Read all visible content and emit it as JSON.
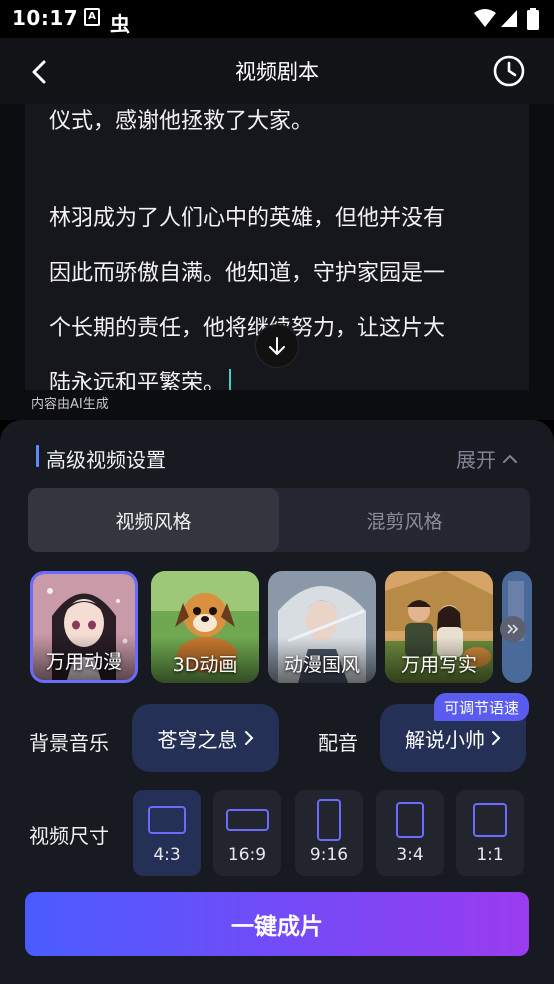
{
  "status_bar": {
    "time": "10:17",
    "a_icon": "A",
    "bug_icon": "虫"
  },
  "nav": {
    "title": "视频剧本",
    "back_icon": "back-arrow-icon",
    "history_icon": "clock-icon"
  },
  "script": {
    "lines": [
      "仪式，感谢他拯救了大家。",
      "林羽成为了人们心中的英雄，但他并没有",
      "因此而骄傲自满。他知道，守护家园是一",
      "个长期的责任，他将继续努力，让这片大",
      "陆永远和平繁荣。"
    ],
    "ai_note": "内容由AI生成"
  },
  "settings": {
    "title": "高级视频设置",
    "expand_label": "展开",
    "tabs": [
      {
        "label": "视频风格",
        "active": true
      },
      {
        "label": "混剪风格",
        "active": false
      }
    ],
    "styles": [
      {
        "label": "万用动漫",
        "selected": true
      },
      {
        "label": "3D动画",
        "selected": false
      },
      {
        "label": "动漫国风",
        "selected": false
      },
      {
        "label": "万用写实",
        "selected": false
      }
    ],
    "music_label": "背景音乐",
    "music_value": "苍穹之息",
    "voice_label": "配音",
    "voice_value": "解说小帅",
    "voice_badge": "可调节语速",
    "size_label": "视频尺寸",
    "sizes": [
      {
        "label": "4:3",
        "selected": true
      },
      {
        "label": "16:9",
        "selected": false
      },
      {
        "label": "9:16",
        "selected": false
      },
      {
        "label": "3:4",
        "selected": false
      },
      {
        "label": "1:1",
        "selected": false
      }
    ],
    "generate_label": "一键成片"
  },
  "colors": {
    "accent": "#6b6cff",
    "pill": "#243056",
    "sheet": "#181a22",
    "cursor": "#3fd3c0"
  }
}
